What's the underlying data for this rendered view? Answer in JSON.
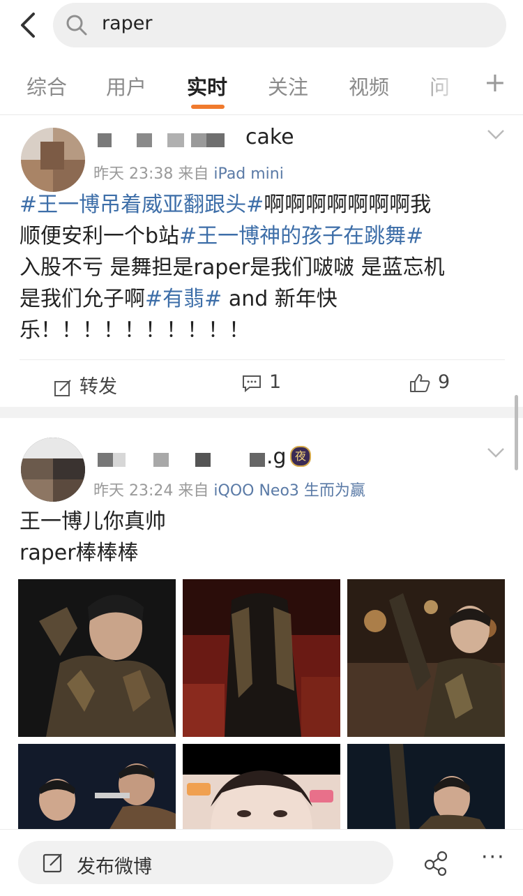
{
  "search": {
    "query": "raper"
  },
  "tabs": [
    {
      "label": "综合"
    },
    {
      "label": "用户"
    },
    {
      "label": "实时"
    },
    {
      "label": "关注"
    },
    {
      "label": "视频"
    },
    {
      "label": "问"
    }
  ],
  "tabs_add": "+",
  "active_tab": "实时",
  "colors": {
    "accent": "#f07a2d",
    "topic": "#3d6ea8"
  },
  "posts": [
    {
      "username_visible": "cake",
      "time": "昨天 23:38",
      "from": "来自",
      "source": "iPad mini",
      "text": {
        "t1": "#王一博吊着威亚翻跟头#",
        "p1": "啊啊啊啊啊啊啊我",
        "p2": "顺便安利一个b站",
        "t2": "#王一博神的孩子在跳舞#",
        "p3": "入股不亏 是舞担是raper是我们啵啵 是蓝忘机",
        "p4": "是我们允子啊",
        "t3": "#有翡#",
        "p5": " and 新年快",
        "p6": "乐！！！！！！！！！！"
      },
      "repost_label": "转发",
      "comment_count": "1",
      "like_count": "9"
    },
    {
      "username_visible": ".g",
      "badge": "夜",
      "time": "昨天 23:24",
      "from": "来自",
      "source": "iQOO Neo3 生而为赢",
      "text": {
        "l1": "王一博儿你真帅",
        "l2": "raper棒棒棒"
      }
    }
  ],
  "bottom": {
    "compose_label": "发布微博",
    "more": "···"
  },
  "icons": [
    "back-icon",
    "search-icon",
    "chevron-down-icon",
    "repost-icon",
    "comment-icon",
    "like-icon",
    "edit-icon",
    "share-icon",
    "more-icon"
  ]
}
